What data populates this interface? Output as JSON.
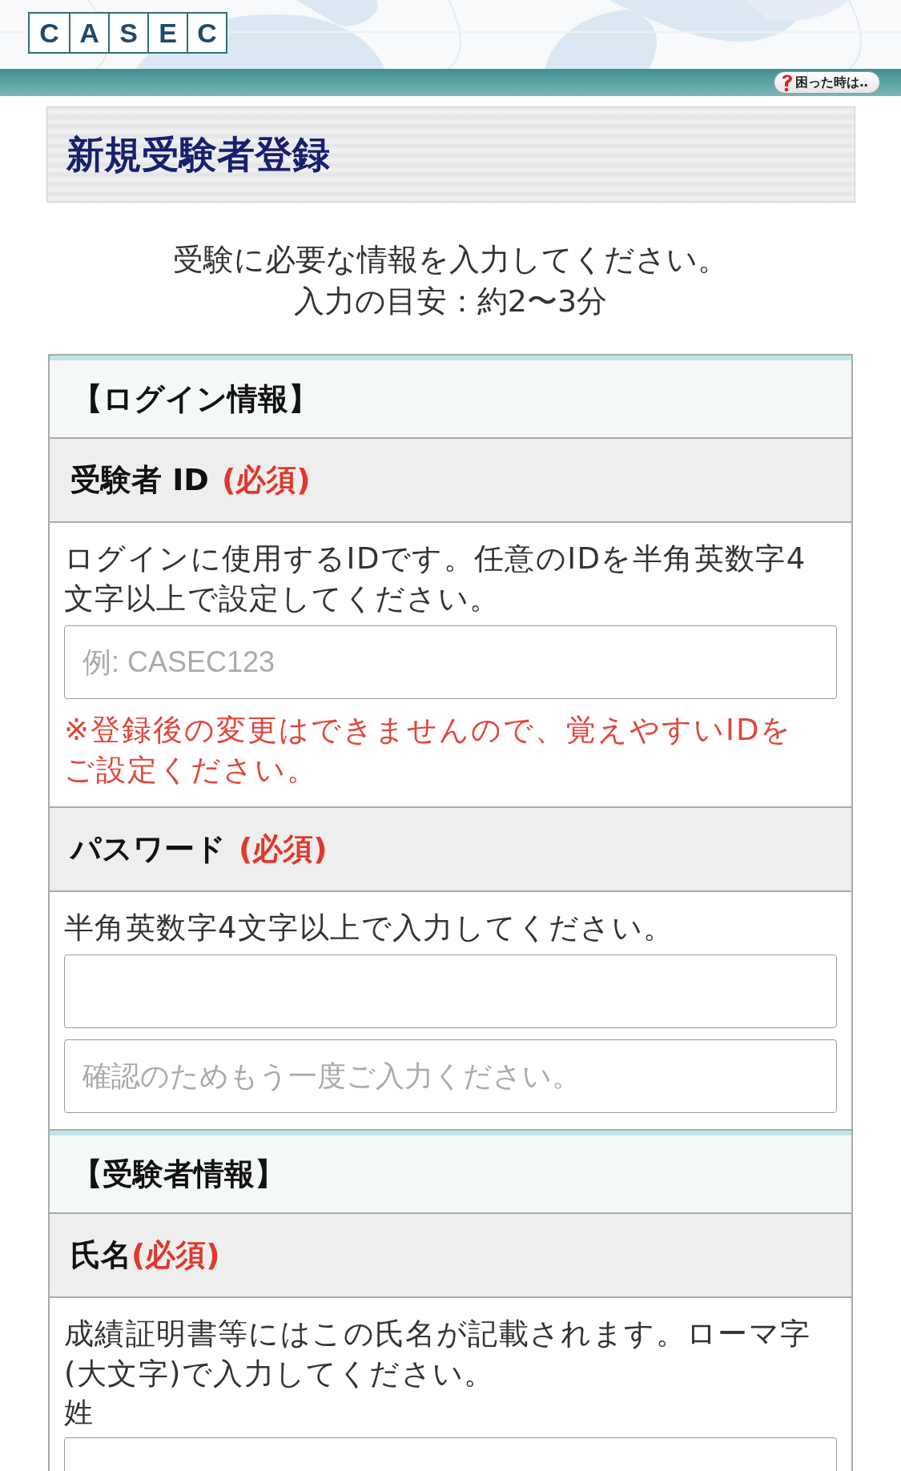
{
  "header": {
    "logo_letters": [
      "C",
      "A",
      "S",
      "E",
      "C"
    ],
    "help_button": "困った時は‥"
  },
  "page_title": "新規受験者登録",
  "intro": [
    "受験に必要な情報を入力してください。",
    "入力の目安：約2〜3分"
  ],
  "sections": [
    {
      "title": "【ログイン情報】",
      "fields": [
        {
          "label": "受験者 ID",
          "required": "(必須)",
          "required_spaced": true,
          "description": "ログインに使用するIDです。任意のIDを半角英数字4文字以上で設定してください。",
          "inputs": [
            {
              "kind": "input",
              "placeholder": "例: CASEC123"
            }
          ],
          "note": "※登録後の変更はできませんので、覚えやすいIDをご設定ください。"
        },
        {
          "label": "パスワード",
          "required": "(必須)",
          "required_spaced": true,
          "description": "半角英数字4文字以上で入力してください。",
          "inputs": [
            {
              "kind": "input"
            },
            {
              "kind": "input",
              "placeholder": "確認のためもう一度ご入力ください。"
            }
          ]
        }
      ]
    },
    {
      "title": "【受験者情報】",
      "fields": [
        {
          "label": "氏名",
          "required": "(必須)",
          "required_spaced": false,
          "description": "成績証明書等にはこの氏名が記載されます。ローマ字(大文字)で入力してください。",
          "sub_label": "姓",
          "inputs": [
            {
              "kind": "input"
            }
          ]
        }
      ]
    }
  ]
}
